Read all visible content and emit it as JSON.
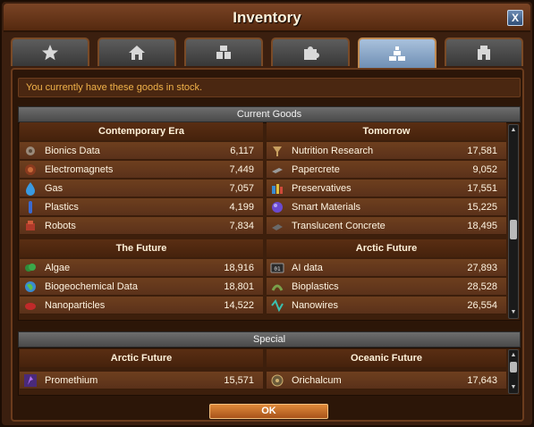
{
  "window": {
    "title": "Inventory",
    "close_label": "X"
  },
  "tabs": [
    {
      "icon": "star-icon",
      "active": false
    },
    {
      "icon": "house-icon",
      "active": false
    },
    {
      "icon": "boxes-icon",
      "active": false
    },
    {
      "icon": "puzzle-icon",
      "active": false
    },
    {
      "icon": "goods-bricks-icon",
      "active": true
    },
    {
      "icon": "building-icon",
      "active": false
    }
  ],
  "info_text": "You currently have these goods in stock.",
  "current_goods": {
    "header": "Current Goods",
    "left_groups": [
      {
        "title": "Contemporary Era",
        "items": [
          {
            "name": "Bionics Data",
            "amount": "6,117",
            "icon": "bionics-icon"
          },
          {
            "name": "Electromagnets",
            "amount": "7,449",
            "icon": "electromagnet-icon"
          },
          {
            "name": "Gas",
            "amount": "7,057",
            "icon": "gas-icon"
          },
          {
            "name": "Plastics",
            "amount": "4,199",
            "icon": "plastics-icon"
          },
          {
            "name": "Robots",
            "amount": "7,834",
            "icon": "robot-icon"
          }
        ]
      },
      {
        "title": "The Future",
        "items": [
          {
            "name": "Algae",
            "amount": "18,916",
            "icon": "algae-icon"
          },
          {
            "name": "Biogeochemical Data",
            "amount": "18,801",
            "icon": "globe-icon"
          },
          {
            "name": "Nanoparticles",
            "amount": "14,522",
            "icon": "nanoparticles-icon"
          }
        ]
      }
    ],
    "right_groups": [
      {
        "title": "Tomorrow",
        "items": [
          {
            "name": "Nutrition Research",
            "amount": "17,581",
            "icon": "nutrition-icon"
          },
          {
            "name": "Papercrete",
            "amount": "9,052",
            "icon": "papercrete-icon"
          },
          {
            "name": "Preservatives",
            "amount": "17,551",
            "icon": "preservatives-icon"
          },
          {
            "name": "Smart Materials",
            "amount": "15,225",
            "icon": "smart-materials-icon"
          },
          {
            "name": "Translucent Concrete",
            "amount": "18,495",
            "icon": "concrete-icon"
          }
        ]
      },
      {
        "title": "Arctic Future",
        "items": [
          {
            "name": "AI data",
            "amount": "27,893",
            "icon": "ai-data-icon"
          },
          {
            "name": "Bioplastics",
            "amount": "28,528",
            "icon": "bioplastics-icon"
          },
          {
            "name": "Nanowires",
            "amount": "26,554",
            "icon": "nanowires-icon"
          }
        ]
      }
    ]
  },
  "special": {
    "header": "Special",
    "left_group": {
      "title": "Arctic Future",
      "items": [
        {
          "name": "Promethium",
          "amount": "15,571",
          "icon": "promethium-icon"
        }
      ]
    },
    "right_group": {
      "title": "Oceanic Future",
      "items": [
        {
          "name": "Orichalcum",
          "amount": "17,643",
          "icon": "orichalcum-icon"
        }
      ]
    }
  },
  "ok_label": "OK"
}
